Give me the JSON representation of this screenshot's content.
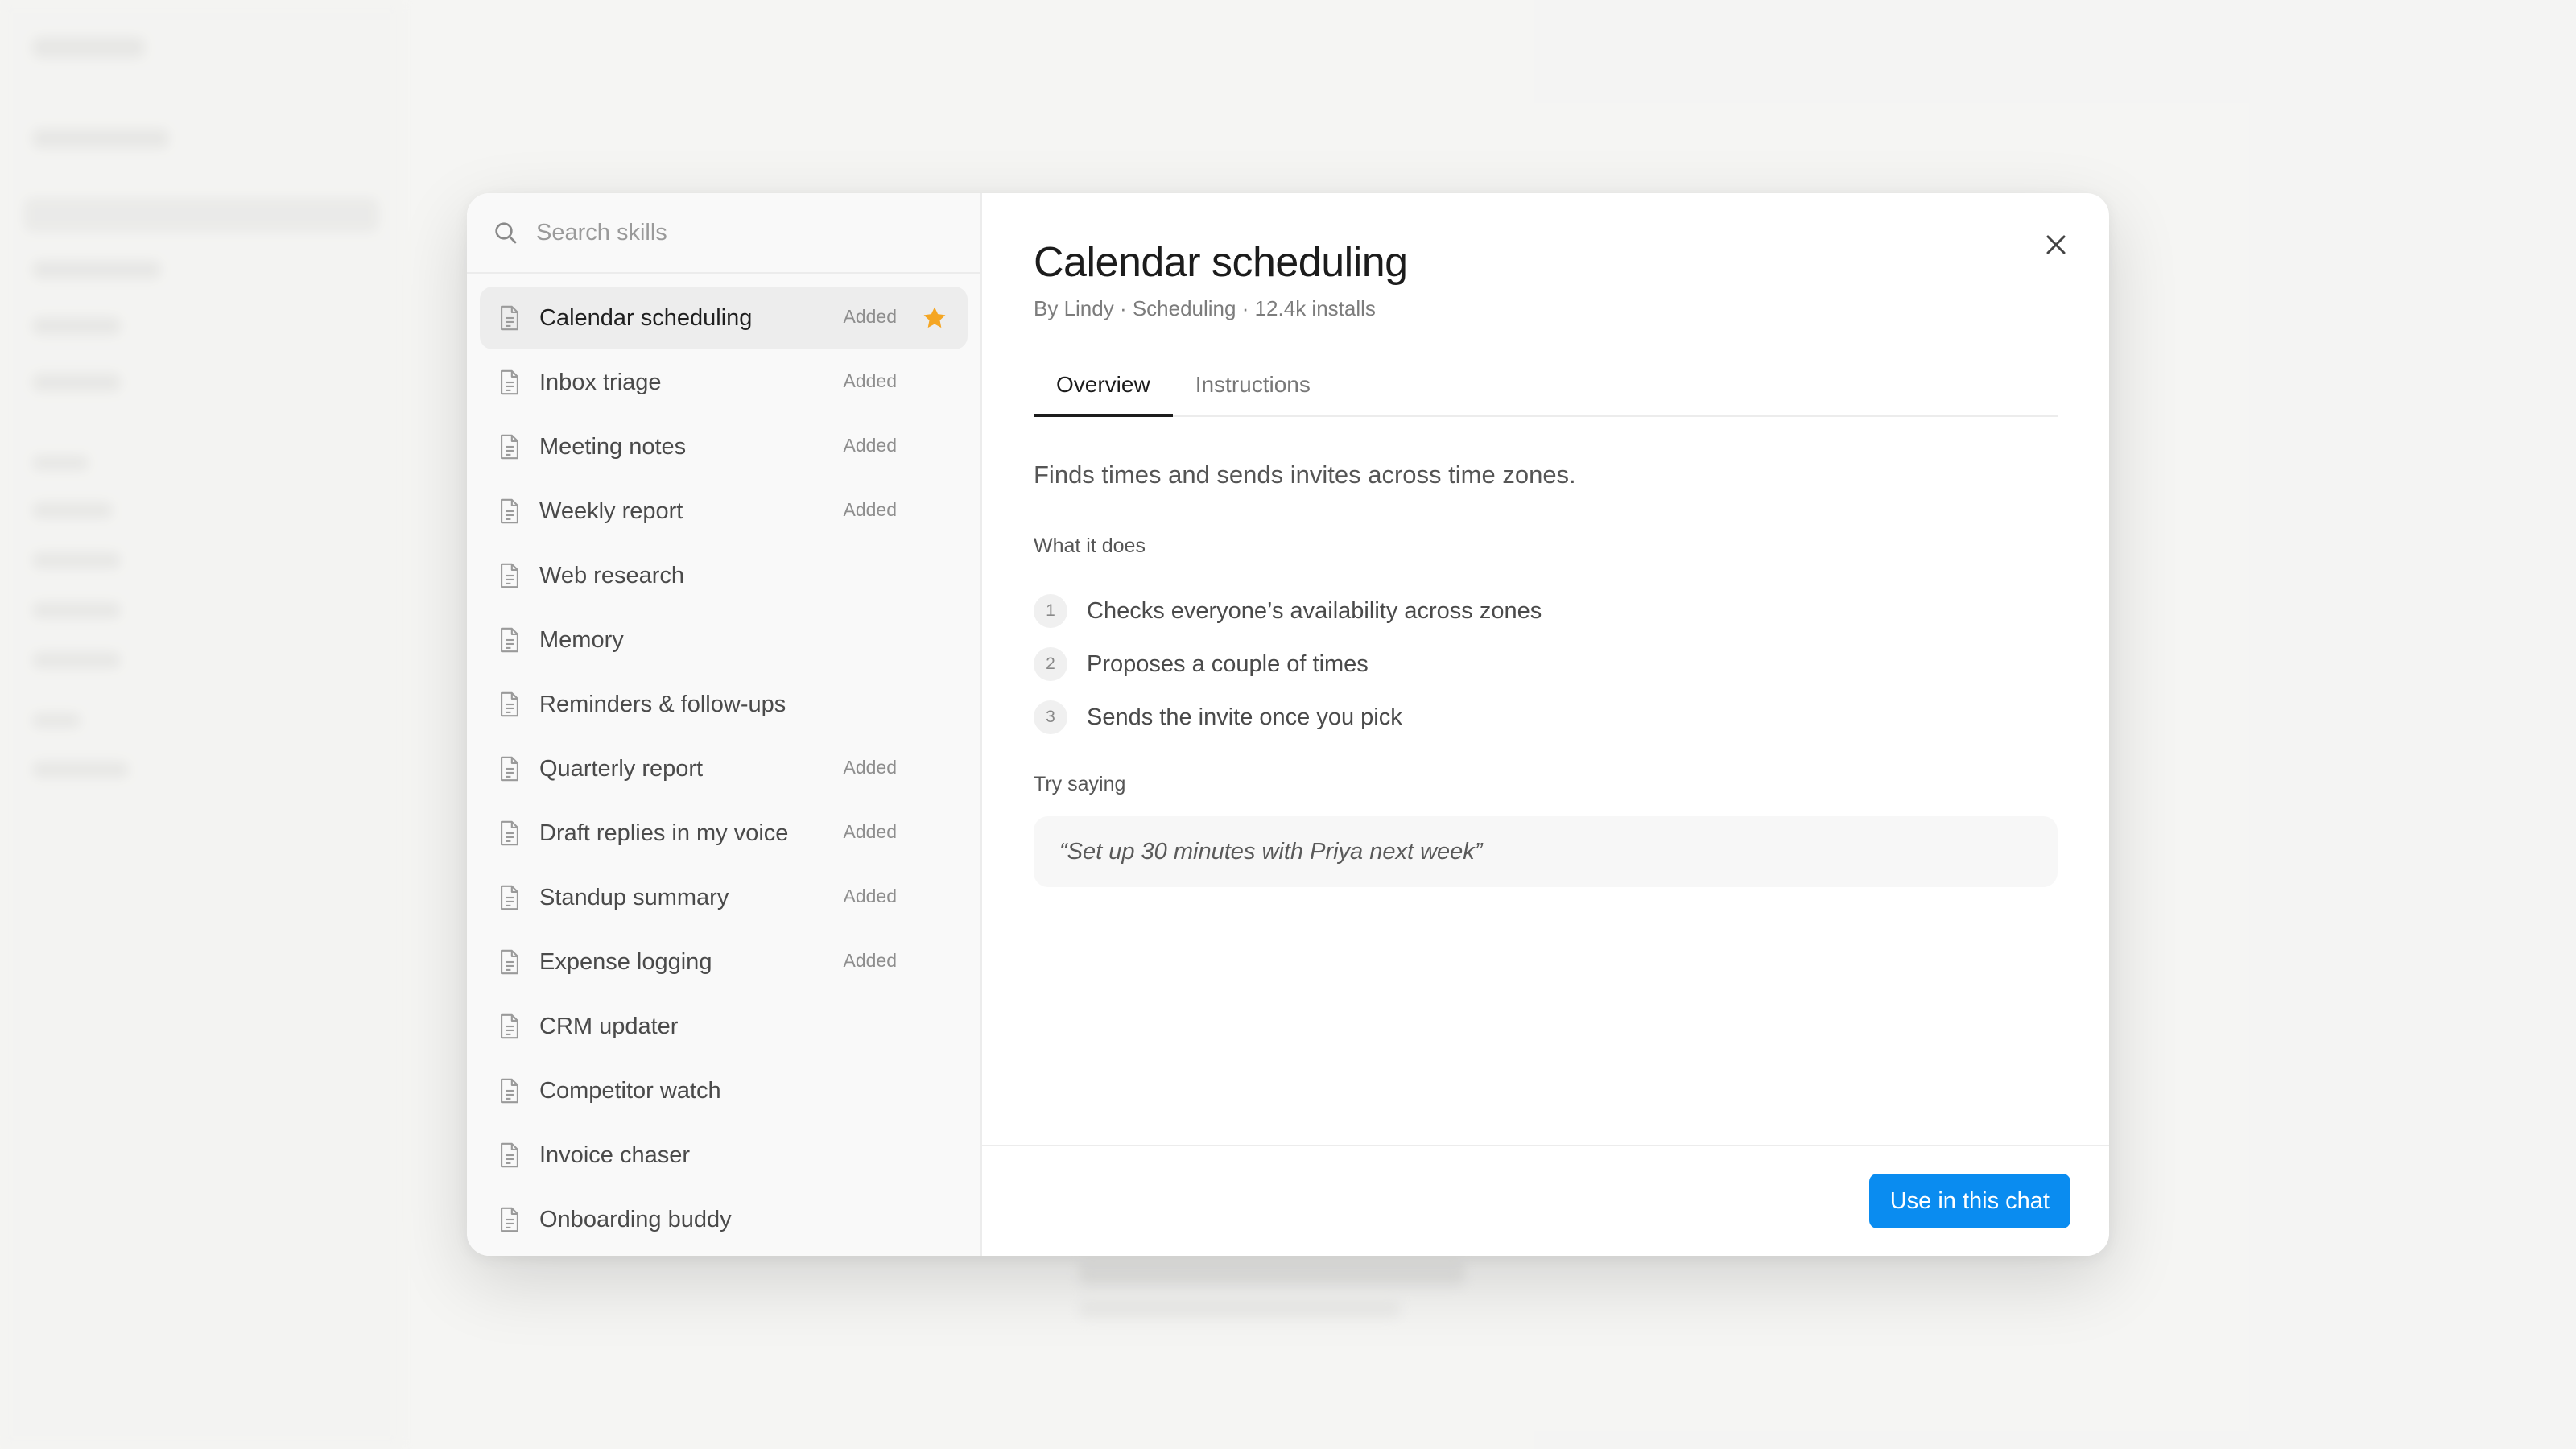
{
  "search": {
    "placeholder": "Search skills"
  },
  "skills": [
    {
      "label": "Calendar scheduling",
      "badge": "Added",
      "starred": true
    },
    {
      "label": "Inbox triage",
      "badge": "Added"
    },
    {
      "label": "Meeting notes",
      "badge": "Added"
    },
    {
      "label": "Weekly report",
      "badge": "Added"
    },
    {
      "label": "Web research",
      "badge": ""
    },
    {
      "label": "Memory",
      "badge": ""
    },
    {
      "label": "Reminders & follow-ups",
      "badge": ""
    },
    {
      "label": "Quarterly report",
      "badge": "Added"
    },
    {
      "label": "Draft replies in my voice",
      "badge": "Added"
    },
    {
      "label": "Standup summary",
      "badge": "Added"
    },
    {
      "label": "Expense logging",
      "badge": "Added"
    },
    {
      "label": "CRM updater",
      "badge": ""
    },
    {
      "label": "Competitor watch",
      "badge": ""
    },
    {
      "label": "Invoice chaser",
      "badge": ""
    },
    {
      "label": "Onboarding buddy",
      "badge": ""
    }
  ],
  "detail": {
    "title": "Calendar scheduling",
    "meta": "By Lindy · Scheduling · 12.4k installs",
    "tabs": [
      "Overview",
      "Instructions"
    ],
    "summary": "Finds times and sends invites across time zones.",
    "what_it_does_label": "What it does",
    "steps": [
      "Checks everyone’s availability across zones",
      "Proposes a couple of times",
      "Sends the invite once you pick"
    ],
    "try_saying_label": "Try saying",
    "try_saying": "“Set up 30 minutes with Priya next week”"
  },
  "footer": {
    "cta_label": "Use in this chat"
  },
  "colors": {
    "accent": "#0a8cf0",
    "star": "#f5a623"
  },
  "icons": {
    "search": "search-icon",
    "skill": "document-icon",
    "star": "star-icon",
    "close": "close-icon"
  }
}
